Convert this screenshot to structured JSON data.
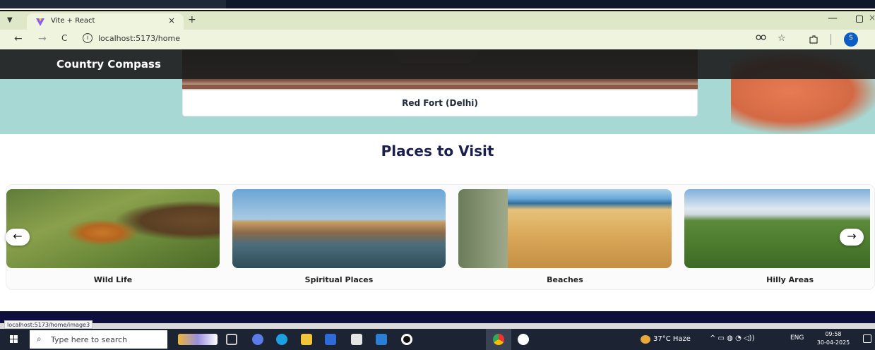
{
  "browser": {
    "tab_title": "Vite + React",
    "tab_close": "×",
    "new_tab": "+",
    "url": "localhost:5173/home",
    "status_url": "localhost:5173/home/image3",
    "profile_initial": "S",
    "nav_back": "←",
    "nav_forward": "→",
    "nav_reload": "C",
    "info_glyph": "i",
    "min_glyph": "—",
    "extra_glyph": "×"
  },
  "site": {
    "brand": "Country Compass",
    "hero_caption": "Red Fort (Delhi)",
    "section_title": "Places to Visit",
    "cards": [
      {
        "label": "Wild Life"
      },
      {
        "label": "Spiritual Places"
      },
      {
        "label": "Beaches"
      },
      {
        "label": "Hilly Areas"
      }
    ],
    "prev_arrow": "←",
    "next_arrow": "→"
  },
  "taskbar": {
    "search_placeholder": "Type here to search",
    "weather": "37°C  Haze",
    "language": "ENG",
    "time": "09:58",
    "date": "30-04-2025"
  },
  "colors": {
    "accent_title": "#1a1f4d",
    "hero_bg": "#a8d8d3",
    "footer": "#0f0f3d",
    "taskbar": "#1c2434"
  }
}
